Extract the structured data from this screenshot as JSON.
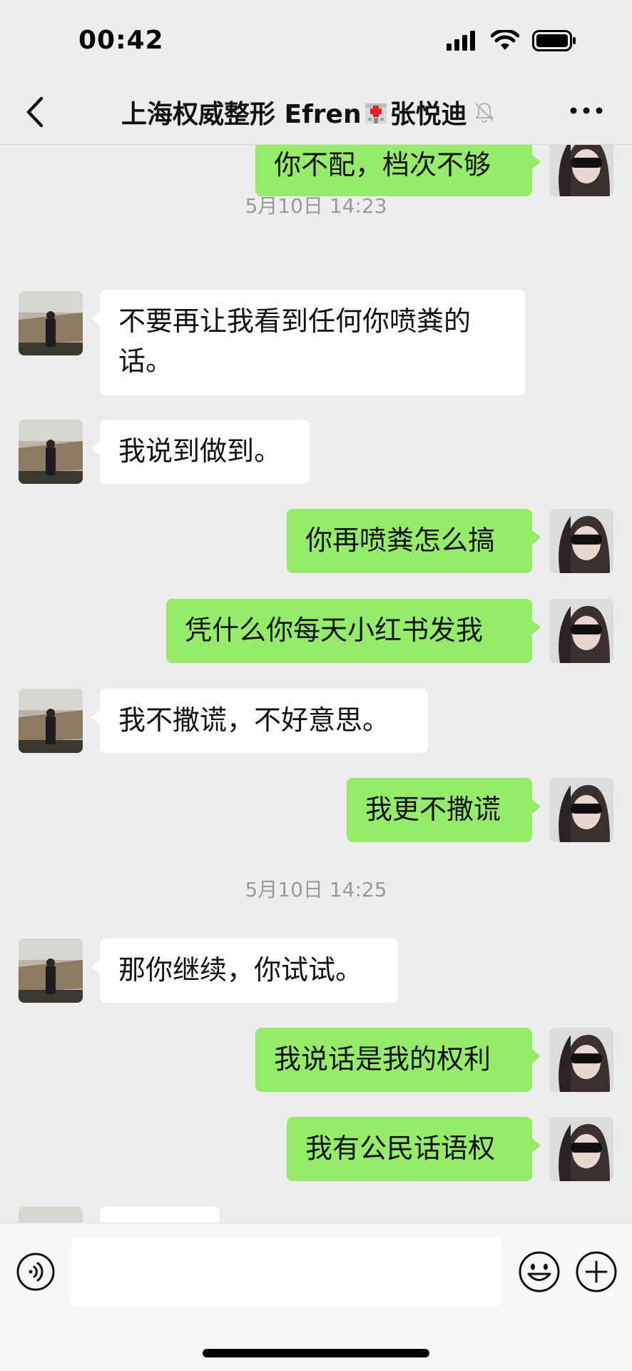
{
  "status_bar": {
    "time": "00:42"
  },
  "header": {
    "title_part1": "上海权威整形 Efren",
    "title_part2": "张悦迪"
  },
  "messages": [
    {
      "type": "bubble",
      "side": "right",
      "text": "你不配，档次不够"
    },
    {
      "type": "timestamp",
      "text": "5月10日 14:23"
    },
    {
      "type": "bubble",
      "side": "left",
      "text": "不要再让我看到任何你喷粪的话。"
    },
    {
      "type": "bubble",
      "side": "left",
      "text": "我说到做到。"
    },
    {
      "type": "bubble",
      "side": "right",
      "text": "你再喷粪怎么搞"
    },
    {
      "type": "bubble",
      "side": "right",
      "text": "凭什么你每天小红书发我"
    },
    {
      "type": "bubble",
      "side": "left",
      "text": "我不撒谎，不好意思。"
    },
    {
      "type": "bubble",
      "side": "right",
      "text": "我更不撒谎"
    },
    {
      "type": "timestamp",
      "text": "5月10日 14:25"
    },
    {
      "type": "bubble",
      "side": "left",
      "text": "那你继续，你试试。"
    },
    {
      "type": "bubble",
      "side": "right",
      "text": "我说话是我的权利"
    },
    {
      "type": "bubble",
      "side": "right",
      "text": "我有公民话语权"
    },
    {
      "type": "bubble",
      "side": "left",
      "text": ""
    }
  ],
  "input": {
    "value": "",
    "placeholder": ""
  },
  "icons": {
    "back": "chevron-left-icon",
    "more": "more-dots-icon",
    "mute": "bell-slash-icon",
    "hospital": "hospital-icon",
    "voice": "voice-icon",
    "emoji": "emoji-icon",
    "plus": "plus-icon"
  },
  "colors": {
    "background": "#ededed",
    "own_bubble": "#95ec69",
    "other_bubble": "#ffffff",
    "timestamp": "#9a9a9a"
  }
}
